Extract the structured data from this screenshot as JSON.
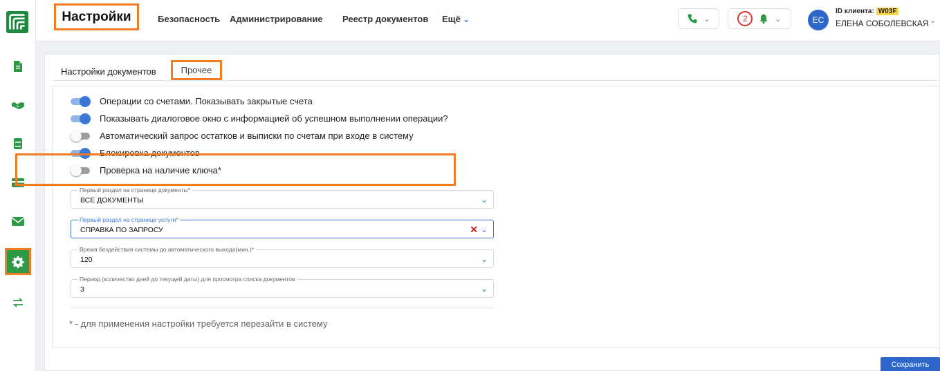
{
  "header": {
    "title": "Настройки",
    "nav": [
      "Безопасность",
      "Администрирование",
      "Реестр документов",
      "Ещё"
    ],
    "notifications_count": "2",
    "user": {
      "initials": "ЕС",
      "client_id_label": "ID клиента:",
      "client_id_value": "W03F",
      "name": "ЕЛЕНА СОБОЛЕВСКАЯ"
    }
  },
  "tabs": {
    "documents": "Настройки документов",
    "other": "Прочее"
  },
  "toggles": [
    {
      "label": "Операции со счетами. Показывать закрытые счета",
      "on": true
    },
    {
      "label": "Показывать диалоговое окно с информацией об успешном выполнении операции?",
      "on": true
    },
    {
      "label": "Автоматический запрос остатков и выписки по счетам при входе в систему",
      "on": false
    },
    {
      "label": "Блокировка документов",
      "on": true
    },
    {
      "label": "Проверка на наличие ключа*",
      "on": false
    }
  ],
  "fields": {
    "docs_first_section": {
      "label": "Первый раздел на странице документы*",
      "value": "ВСЕ ДОКУМЕНТЫ"
    },
    "services_first_section": {
      "label": "Первый раздел на странице услуги*",
      "value": "СПРАВКА ПО ЗАПРОСУ"
    },
    "idle_time": {
      "label": "Время бездействия системы до автоматического выхода(мин.)*",
      "value": "120"
    },
    "period": {
      "label": "Период (количество дней до текущей даты) для просмотра списка документов",
      "value": "3"
    }
  },
  "note": "* - для применения настройки требуется перезайти в систему",
  "save_label": "Сохранить",
  "colors": {
    "accent": "#3a78d8",
    "brand": "#1f8a3f",
    "highlight": "#f07c25",
    "primary_button": "#2f66c9"
  }
}
